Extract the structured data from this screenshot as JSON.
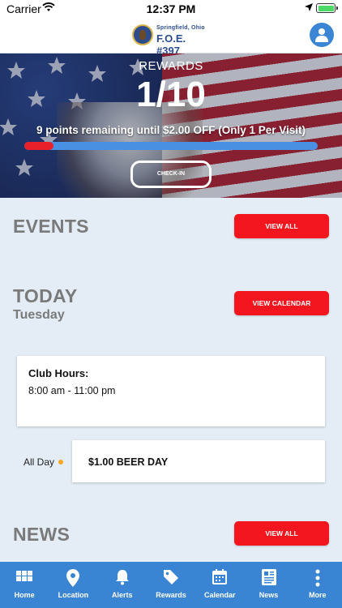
{
  "status_bar": {
    "carrier": "Carrier",
    "time": "12:37 PM"
  },
  "header": {
    "logo_subtitle": "Springfield, Ohio",
    "logo_title": "F.O.E. #397"
  },
  "rewards": {
    "label": "REWARDS",
    "count": "1/10",
    "message": "9 points remaining until $2.00 OFF (Only 1 Per Visit)",
    "progress_fraction": 0.1,
    "checkin_label": "CHECK-IN"
  },
  "events": {
    "title": "EVENTS",
    "view_all_label": "VIEW ALL"
  },
  "today": {
    "title": "TODAY",
    "day": "Tuesday",
    "view_calendar_label": "VIEW CALENDAR",
    "club_hours_title": "Club Hours:",
    "club_hours_value": "8:00 am - 11:00 pm",
    "event_time": "All Day",
    "event_title": "$1.00 BEER DAY"
  },
  "news": {
    "title": "NEWS",
    "view_all_label": "VIEW ALL"
  },
  "tabs": [
    {
      "label": "Home",
      "icon": "grid-icon"
    },
    {
      "label": "Location",
      "icon": "map-pin-icon"
    },
    {
      "label": "Alerts",
      "icon": "bell-icon"
    },
    {
      "label": "Rewards",
      "icon": "tag-icon"
    },
    {
      "label": "Calendar",
      "icon": "calendar-icon"
    },
    {
      "label": "News",
      "icon": "newspaper-icon"
    },
    {
      "label": "More",
      "icon": "more-dots-icon"
    }
  ],
  "colors": {
    "accent_red": "#f4161e",
    "tab_bar_blue": "#3a85d3",
    "progress_blue": "#4a90e2",
    "dot_orange": "#f5a623"
  }
}
